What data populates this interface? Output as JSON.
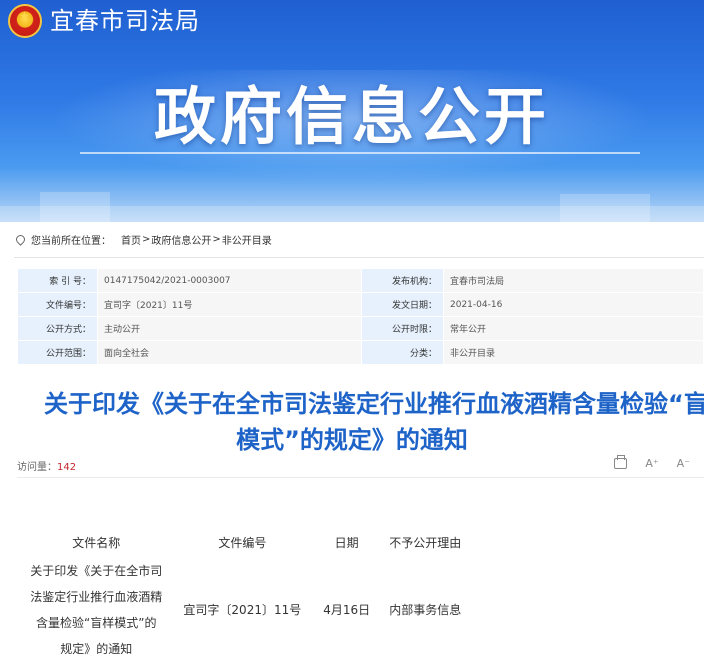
{
  "header": {
    "site_name": "宜春市司法局",
    "banner_title": "政府信息公开",
    "emblem": "national-emblem-icon"
  },
  "breadcrumb": {
    "lead": "您当前所在位置：",
    "items": [
      "首页",
      "政府信息公开",
      "非公开目录"
    ],
    "separator": ">"
  },
  "info": {
    "rows": [
      {
        "l1": "索 引 号：",
        "v1": "0147175042/2021-0003007",
        "l2": "发布机构：",
        "v2": "宜春市司法局"
      },
      {
        "l1": "文件编号：",
        "v1": "宜司字〔2021〕11号",
        "l2": "发文日期：",
        "v2": "2021-04-16"
      },
      {
        "l1": "公开方式：",
        "v1": "主动公开",
        "l2": "公开时限：",
        "v2": "常年公开"
      },
      {
        "l1": "公开范围：",
        "v1": "面向全社会",
        "l2": "分类：",
        "v2": "非公开目录"
      }
    ]
  },
  "article": {
    "title_line1": "关于印发《关于在全市司法鉴定行业推行血液酒精含量检验“盲样",
    "title_line2": "模式”的规定》的通知",
    "views_label": "访问量：",
    "views": "142",
    "tools": {
      "font_larger": "A⁺",
      "font_smaller": "A⁻"
    }
  },
  "doc_table": {
    "headers": [
      "文件名称",
      "文件编号",
      "日期",
      "不予公开理由"
    ],
    "row": {
      "name_lines": [
        "关于印发《关于在全市司",
        "法鉴定行业推行血液酒精",
        "含量检验“盲样模式”的",
        "规定》的通知"
      ],
      "number": "宜司字〔2021〕11号",
      "date": "4月16日",
      "reason": "内部事务信息"
    }
  }
}
